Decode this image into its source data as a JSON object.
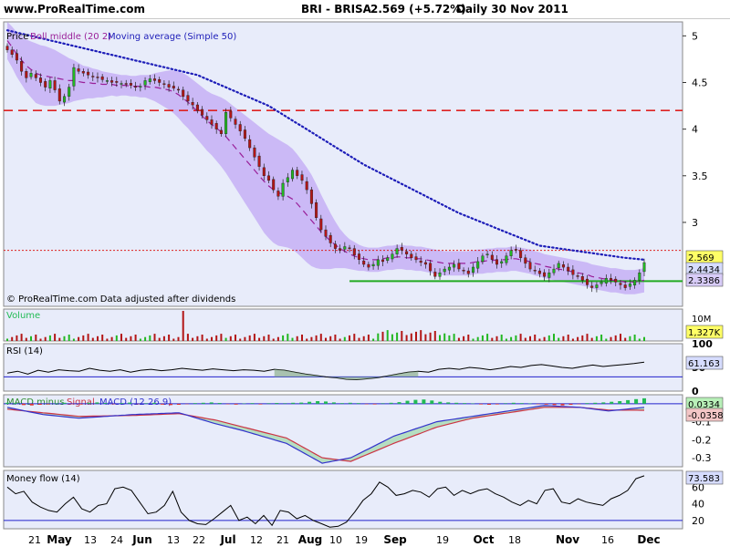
{
  "header": {
    "site": "www.ProRealTime.com",
    "symbol": "BRI - BRISA",
    "price": "2.569 (+5.72%)",
    "period": "Daily  30 Nov 2011"
  },
  "colors": {
    "panel_bg": "#e8ecfa",
    "candle_up": "#22b722",
    "candle_down": "#b31616",
    "boll_band": "#c8b4f5",
    "boll_middle": "#991f99",
    "ma50": "#1d1db8",
    "resistance": "#dd2222",
    "support": "#22aa22",
    "hist_pos": "#22bb55",
    "hist_neg": "#dd3333",
    "macd_line": "#3333cc",
    "signal_line": "#cc3344",
    "level_line": "#2222cc"
  },
  "chart_data": [
    {
      "type": "candlestick",
      "title": "",
      "legend": [
        "Price",
        "Boll middle (20 2)",
        "Moving average (Simple 50)"
      ],
      "footnote": "© ProRealTime.com  Data adjusted after dividends",
      "ylim": [
        2.1,
        5.15
      ],
      "yticks": [
        "5",
        "4.5",
        "4",
        "3.5",
        "3"
      ],
      "x_labels": [
        "21",
        "May",
        "13",
        "24",
        "Jun",
        "13",
        "22",
        "Jul",
        "12",
        "21",
        "Aug",
        "10",
        "19",
        "Sep",
        "19",
        "Oct",
        "18",
        "Nov",
        "16",
        "Dec"
      ],
      "close": [
        4.85,
        4.8,
        4.74,
        4.62,
        4.55,
        4.6,
        4.55,
        4.5,
        4.45,
        4.52,
        4.42,
        4.3,
        4.35,
        4.45,
        4.66,
        4.62,
        4.6,
        4.58,
        4.56,
        4.55,
        4.53,
        4.52,
        4.5,
        4.5,
        4.49,
        4.48,
        4.47,
        4.45,
        4.46,
        4.52,
        4.54,
        4.52,
        4.5,
        4.48,
        4.45,
        4.44,
        4.42,
        4.35,
        4.3,
        4.26,
        4.2,
        4.15,
        4.1,
        4.05,
        4.0,
        3.95,
        4.18,
        4.12,
        4.05,
        3.98,
        3.9,
        3.8,
        3.7,
        3.6,
        3.5,
        3.45,
        3.35,
        3.28,
        3.42,
        3.48,
        3.56,
        3.5,
        3.45,
        3.35,
        3.2,
        3.05,
        2.92,
        2.85,
        2.78,
        2.72,
        2.7,
        2.74,
        2.72,
        2.65,
        2.6,
        2.55,
        2.52,
        2.55,
        2.6,
        2.58,
        2.62,
        2.66,
        2.72,
        2.7,
        2.66,
        2.62,
        2.6,
        2.57,
        2.55,
        2.48,
        2.42,
        2.46,
        2.5,
        2.52,
        2.55,
        2.5,
        2.48,
        2.45,
        2.52,
        2.58,
        2.64,
        2.66,
        2.6,
        2.55,
        2.58,
        2.64,
        2.7,
        2.71,
        2.62,
        2.56,
        2.5,
        2.48,
        2.45,
        2.42,
        2.46,
        2.5,
        2.56,
        2.52,
        2.48,
        2.44,
        2.42,
        2.38,
        2.33,
        2.3,
        2.33,
        2.36,
        2.4,
        2.38,
        2.36,
        2.33,
        2.3,
        2.34,
        2.38,
        2.46,
        2.569
      ],
      "boll_middle": [
        4.95,
        4.88,
        4.8,
        4.74,
        4.68,
        4.64,
        4.6,
        4.58,
        4.57,
        4.56,
        4.55,
        4.54,
        4.53,
        4.52,
        4.52,
        4.51,
        4.5,
        4.5,
        4.49,
        4.49,
        4.48,
        4.48,
        4.48,
        4.47,
        4.47,
        4.47,
        4.46,
        4.46,
        4.46,
        4.46,
        4.45,
        4.45,
        4.44,
        4.43,
        4.42,
        4.4,
        4.37,
        4.33,
        4.29,
        4.24,
        4.19,
        4.14,
        4.09,
        4.05,
        4.01,
        3.97,
        3.92,
        3.86,
        3.8,
        3.74,
        3.68,
        3.62,
        3.56,
        3.5,
        3.44,
        3.39,
        3.35,
        3.32,
        3.3,
        3.28,
        3.25,
        3.2,
        3.14,
        3.08,
        3.02,
        2.96,
        2.9,
        2.85,
        2.8,
        2.76,
        2.72,
        2.69,
        2.66,
        2.64,
        2.62,
        2.61,
        2.6,
        2.6,
        2.6,
        2.61,
        2.62,
        2.62,
        2.63,
        2.63,
        2.62,
        2.62,
        2.61,
        2.61,
        2.6,
        2.59,
        2.58,
        2.57,
        2.56,
        2.56,
        2.56,
        2.56,
        2.56,
        2.56,
        2.57,
        2.58,
        2.58,
        2.59,
        2.59,
        2.6,
        2.6,
        2.6,
        2.61,
        2.61,
        2.6,
        2.59,
        2.58,
        2.56,
        2.55,
        2.53,
        2.52,
        2.51,
        2.5,
        2.49,
        2.48,
        2.47,
        2.46,
        2.45,
        2.44,
        2.42,
        2.41,
        2.4,
        2.39,
        2.38,
        2.38,
        2.37,
        2.36,
        2.36,
        2.36,
        2.37,
        2.38
      ],
      "boll_width": [
        0.2,
        0.22,
        0.24,
        0.26,
        0.28,
        0.3,
        0.32,
        0.32,
        0.32,
        0.31,
        0.3,
        0.28,
        0.26,
        0.24,
        0.22,
        0.2,
        0.18,
        0.17,
        0.16,
        0.15,
        0.14,
        0.13,
        0.12,
        0.12,
        0.11,
        0.11,
        0.11,
        0.11,
        0.12,
        0.12,
        0.13,
        0.15,
        0.17,
        0.19,
        0.21,
        0.23,
        0.25,
        0.27,
        0.28,
        0.29,
        0.3,
        0.31,
        0.32,
        0.33,
        0.35,
        0.37,
        0.39,
        0.41,
        0.43,
        0.45,
        0.47,
        0.49,
        0.51,
        0.53,
        0.55,
        0.56,
        0.57,
        0.57,
        0.56,
        0.55,
        0.54,
        0.53,
        0.52,
        0.51,
        0.49,
        0.45,
        0.4,
        0.35,
        0.3,
        0.25,
        0.21,
        0.18,
        0.16,
        0.15,
        0.14,
        0.13,
        0.13,
        0.13,
        0.13,
        0.13,
        0.13,
        0.13,
        0.13,
        0.13,
        0.13,
        0.13,
        0.13,
        0.13,
        0.13,
        0.13,
        0.13,
        0.13,
        0.13,
        0.13,
        0.13,
        0.13,
        0.13,
        0.13,
        0.13,
        0.13,
        0.13,
        0.13,
        0.13,
        0.13,
        0.13,
        0.13,
        0.13,
        0.13,
        0.13,
        0.13,
        0.13,
        0.13,
        0.13,
        0.13,
        0.13,
        0.13,
        0.13,
        0.13,
        0.13,
        0.13,
        0.13,
        0.13,
        0.13,
        0.13,
        0.13,
        0.13,
        0.13,
        0.13,
        0.13,
        0.13,
        0.13,
        0.13,
        0.13,
        0.13,
        0.13
      ],
      "ma50_anchors": [
        [
          0,
          5.06
        ],
        [
          20,
          4.82
        ],
        [
          40,
          4.58
        ],
        [
          55,
          4.25
        ],
        [
          75,
          3.62
        ],
        [
          95,
          3.1
        ],
        [
          112,
          2.75
        ],
        [
          130,
          2.62
        ],
        [
          150,
          2.52
        ],
        [
          170,
          2.44
        ],
        [
          178,
          2.42
        ]
      ],
      "hlines": [
        {
          "value": 4.2,
          "style": "dashed-red"
        },
        {
          "value": 2.7,
          "style": "dotted-red"
        }
      ],
      "support": {
        "value": 2.37,
        "from_index": 72
      },
      "right_labels": [
        "2.569",
        "2.4434",
        "2.3386"
      ]
    },
    {
      "type": "bar",
      "title": "Volume",
      "yticks": [
        "10M"
      ],
      "last_label": "1,327K",
      "spike": {
        "index": 37,
        "value": "10M"
      }
    },
    {
      "type": "line",
      "title": "RSI (14)",
      "ylim": [
        0,
        100
      ],
      "yticks": [
        "100",
        "50",
        "0"
      ],
      "level": 30,
      "values": [
        38,
        42,
        36,
        44,
        40,
        45,
        43,
        42,
        48,
        44,
        42,
        45,
        40,
        44,
        46,
        43,
        45,
        48,
        46,
        44,
        47,
        45,
        43,
        45,
        44,
        42,
        46,
        44,
        40,
        36,
        33,
        30,
        28,
        25,
        24,
        26,
        28,
        32,
        36,
        40,
        42,
        40,
        46,
        48,
        46,
        50,
        48,
        45,
        48,
        52,
        50,
        54,
        56,
        53,
        50,
        48,
        52,
        55,
        52,
        54,
        56,
        58,
        61
      ],
      "last_label": "61.163"
    },
    {
      "type": "line",
      "title": "MACD minus Signal",
      "series": [
        {
          "name": "Signal"
        },
        {
          "name": "MACD (12 26 9)"
        }
      ],
      "ylim": [
        -0.35,
        0.05
      ],
      "yticks": [
        "-0.1",
        "-0.2",
        "-0.3"
      ],
      "macd_anchors": [
        [
          0,
          -0.02
        ],
        [
          10,
          -0.06
        ],
        [
          20,
          -0.08
        ],
        [
          35,
          -0.06
        ],
        [
          48,
          -0.05
        ],
        [
          58,
          -0.11
        ],
        [
          66,
          -0.15
        ],
        [
          78,
          -0.22
        ],
        [
          88,
          -0.33
        ],
        [
          96,
          -0.3
        ],
        [
          108,
          -0.18
        ],
        [
          120,
          -0.1
        ],
        [
          130,
          -0.07
        ],
        [
          140,
          -0.04
        ],
        [
          150,
          -0.01
        ],
        [
          160,
          -0.02
        ],
        [
          168,
          -0.04
        ],
        [
          178,
          -0.02
        ]
      ],
      "signal_anchors": [
        [
          0,
          -0.03
        ],
        [
          10,
          -0.05
        ],
        [
          20,
          -0.07
        ],
        [
          35,
          -0.065
        ],
        [
          48,
          -0.055
        ],
        [
          58,
          -0.09
        ],
        [
          66,
          -0.13
        ],
        [
          78,
          -0.19
        ],
        [
          88,
          -0.3
        ],
        [
          96,
          -0.32
        ],
        [
          108,
          -0.22
        ],
        [
          120,
          -0.13
        ],
        [
          130,
          -0.08
        ],
        [
          140,
          -0.05
        ],
        [
          150,
          -0.02
        ],
        [
          160,
          -0.02
        ],
        [
          168,
          -0.035
        ],
        [
          178,
          -0.036
        ]
      ],
      "hist_values": [
        0.006,
        0.004,
        -0.008,
        -0.01,
        -0.006,
        -0.004,
        0.003,
        0.006,
        -0.002,
        -0.004,
        0.006,
        0.008,
        0.005,
        -0.003,
        0.004,
        0.007,
        -0.002,
        0.003,
        0.006,
        -0.005,
        -0.008,
        -0.006,
        -0.002,
        0.004,
        0.006,
        0.008,
        0.005,
        -0.003,
        -0.005,
        0.002,
        0.004,
        -0.004,
        0.003,
        0.005,
        0.003,
        0.006,
        0.007,
        0.012,
        0.016,
        0.014,
        0.008,
        0.004,
        0.006,
        0.004,
        -0.003,
        -0.004,
        0.003,
        0.006,
        0.01,
        0.018,
        0.024,
        0.026,
        0.02,
        0.012,
        0.008,
        0.006,
        0.004,
        0.002,
        -0.004,
        -0.006,
        -0.004,
        0.003,
        0.006,
        0.004,
        0.002,
        -0.003,
        -0.005,
        -0.008,
        -0.01,
        -0.006,
        -0.003,
        0.004,
        0.006,
        0.008,
        0.012,
        0.016,
        0.022,
        0.028,
        0.033
      ],
      "right_labels": [
        "0.0334",
        "-0.0358"
      ]
    },
    {
      "type": "line",
      "title": "Money flow (14)",
      "ylim": [
        10,
        80
      ],
      "yticks": [
        "60",
        "40",
        "20"
      ],
      "level": 20,
      "values": [
        60,
        52,
        55,
        42,
        36,
        32,
        30,
        40,
        48,
        34,
        30,
        38,
        40,
        58,
        60,
        56,
        42,
        28,
        30,
        38,
        55,
        30,
        20,
        16,
        15,
        22,
        30,
        38,
        20,
        24,
        16,
        26,
        14,
        32,
        30,
        22,
        26,
        20,
        16,
        12,
        13,
        18,
        30,
        44,
        52,
        66,
        60,
        50,
        52,
        56,
        54,
        48,
        58,
        60,
        50,
        56,
        52,
        56,
        58,
        52,
        48,
        42,
        38,
        44,
        40,
        56,
        58,
        42,
        40,
        46,
        42,
        40,
        38,
        46,
        50,
        56,
        70,
        73.583
      ],
      "last_label": "73.583"
    }
  ]
}
